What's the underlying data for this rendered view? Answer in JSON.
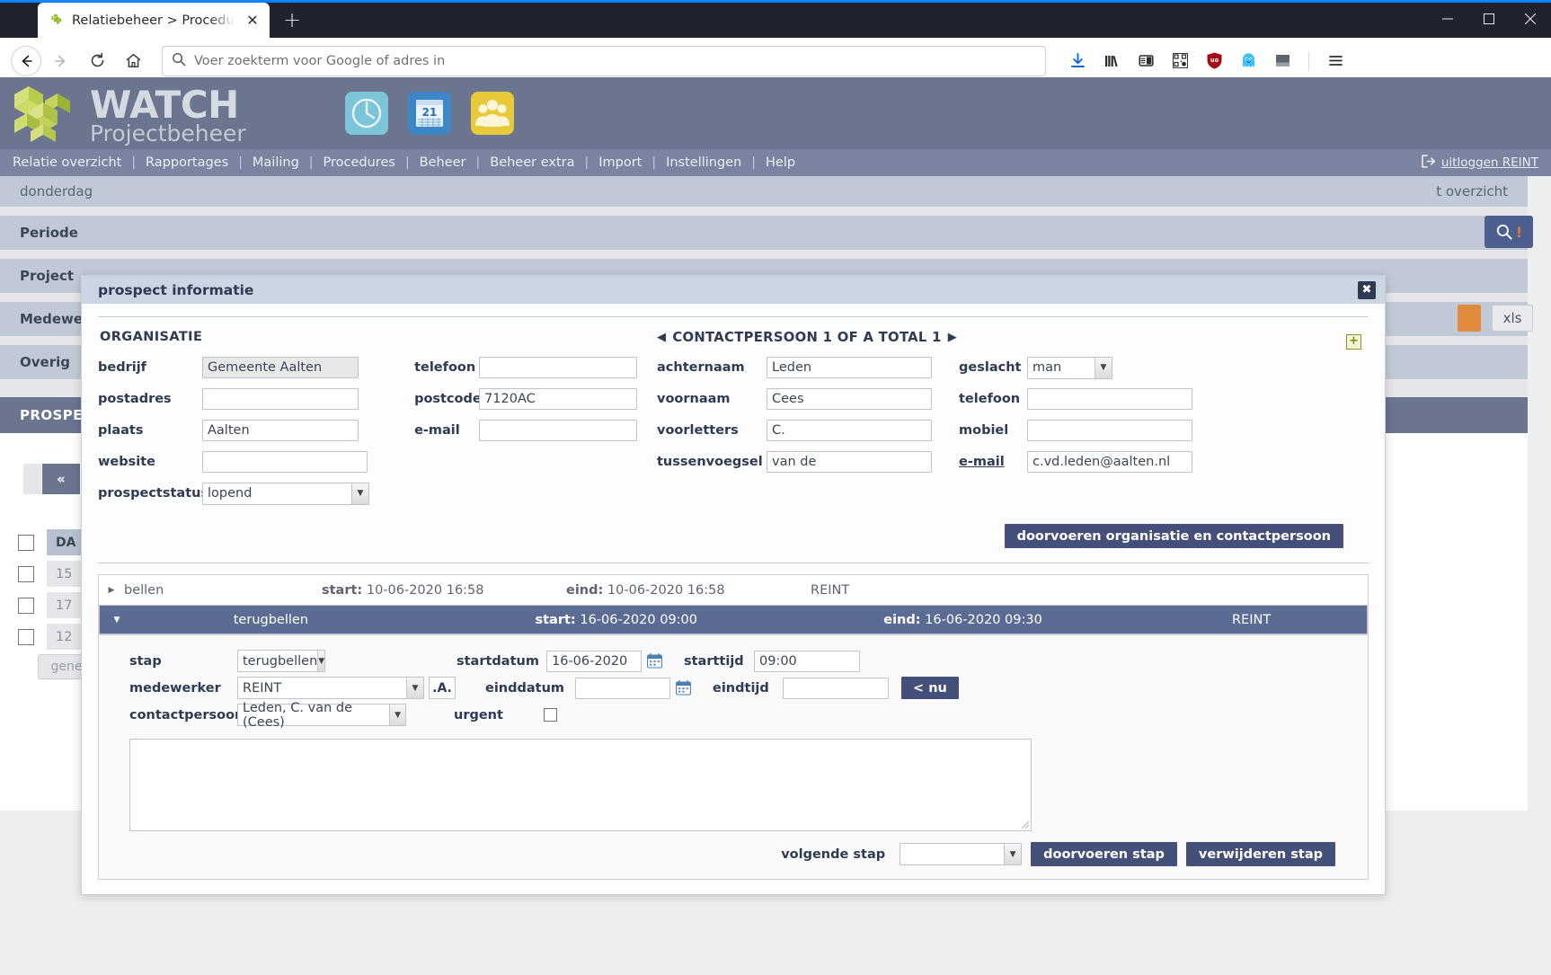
{
  "browser": {
    "tab": {
      "title_main": "Relatiebeheer > Procedures > P",
      "sep": ">",
      "favicon": "puzzle-icon",
      "close": "✕"
    },
    "newtab_label": "+",
    "window_controls": {
      "minimize": "─",
      "maximize": "☐",
      "close": "✕"
    },
    "toolbar": {
      "back": "←",
      "forward": "→",
      "reload": "⟳",
      "home": "⌂",
      "url_placeholder": "Voer zoekterm voor Google of adres in",
      "icons": [
        "download-icon",
        "library-icon",
        "reader-view-icon",
        "qr-code-icon",
        "ublock-icon",
        "ghostery-icon",
        "extension-icon",
        "menu-icon"
      ]
    }
  },
  "app": {
    "logo": {
      "brand": "WATCH",
      "sub": "Projectbeheer"
    },
    "header_icons": [
      "clock-icon",
      "calendar-icon",
      "people-icon"
    ],
    "menu": [
      "Relatie overzicht",
      "Rapportages",
      "Mailing",
      "Procedures",
      "Beheer",
      "Beheer extra",
      "Import",
      "Instellingen",
      "Help"
    ],
    "menu_separator": "|",
    "logout": "uitloggen REINT"
  },
  "background": {
    "date_left": "donderdag",
    "date_right": "t overzicht",
    "filters": [
      "Periode",
      "Project",
      "Medewerk",
      "Overig"
    ],
    "prospect_header": "PROSPEC",
    "pager": [
      "«",
      "‹"
    ],
    "table_header": "DA",
    "table_rows": [
      "15",
      "17",
      "12"
    ],
    "gen_button": "gene",
    "xls_button": "xls"
  },
  "modal": {
    "title": "prospect informatie",
    "close": "✖",
    "organisatie": {
      "heading": "ORGANISATIE",
      "fields": [
        {
          "label": "bedrijf",
          "value": "Gemeente Aalten",
          "gray": true
        },
        {
          "label": "postadres",
          "value": ""
        },
        {
          "label": "plaats",
          "value": "Aalten"
        },
        {
          "label": "website",
          "value": ""
        }
      ],
      "fields_right": [
        {
          "label": "telefoon",
          "value": ""
        },
        {
          "label": "postcode",
          "value": "7120AC"
        },
        {
          "label": "e-mail",
          "value": ""
        }
      ],
      "status_label": "prospectstatus",
      "status_value": "lopend"
    },
    "contactpersoon": {
      "heading": "CONTACTPERSOON 1 OF A TOTAL 1",
      "prev_arrow": "◀",
      "next_arrow": "▶",
      "add_button": "+",
      "fields": [
        {
          "label": "achternaam",
          "value": "Leden"
        },
        {
          "label": "voornaam",
          "value": "Cees"
        },
        {
          "label": "voorletters",
          "value": "C."
        },
        {
          "label": "tussenvoegsel",
          "value": "van de"
        }
      ],
      "fields_right": [
        {
          "label": "geslacht",
          "value": "man",
          "select": true
        },
        {
          "label": "telefoon",
          "value": ""
        },
        {
          "label": "mobiel",
          "value": ""
        },
        {
          "label": "e-mail",
          "value": "c.vd.leden@aalten.nl",
          "underline": true
        }
      ]
    },
    "submit_org_button": "doorvoeren organisatie en contactpersoon",
    "procedures": [
      {
        "triangle": "▶",
        "name": "bellen",
        "start_label": "start:",
        "start_value": "10-06-2020 16:58",
        "eind_label": "eind:",
        "eind_value": "10-06-2020 16:58",
        "user": "REINT",
        "selected": false
      },
      {
        "triangle": "▼",
        "name": "terugbellen",
        "start_label": "start:",
        "start_value": "16-06-2020 09:00",
        "eind_label": "eind:",
        "eind_value": "16-06-2020 09:30",
        "user": "REINT",
        "selected": true
      }
    ],
    "step": {
      "stap_label": "stap",
      "stap_value": "terugbellen",
      "medewerker_label": "medewerker",
      "medewerker_value": "REINT",
      "medewerker_btn": ".A.",
      "contactpersoon_label": "contactpersoon",
      "contactpersoon_value": "Leden, C. van de (Cees)",
      "startdatum_label": "startdatum",
      "startdatum_value": "16-06-2020",
      "einddatum_label": "einddatum",
      "einddatum_value": "",
      "urgent_label": "urgent",
      "urgent_checked": false,
      "starttijd_label": "starttijd",
      "starttijd_value": "09:00",
      "eindtijd_label": "eindtijd",
      "eindtijd_value": "",
      "nu_button": "< nu",
      "notes_value": "",
      "volgende_stap_label": "volgende stap",
      "volgende_stap_value": "",
      "doorvoeren_button": "doorvoeren stap",
      "verwijderen_button": "verwijderen stap"
    }
  },
  "colors": {
    "app_header": "#6b7590",
    "menu_bar": "#7a84a0",
    "accent_button": "#445079",
    "selected_row": "#5c6b93",
    "modal_head": "#ccd5e3",
    "label_text": "#2f3b55"
  }
}
